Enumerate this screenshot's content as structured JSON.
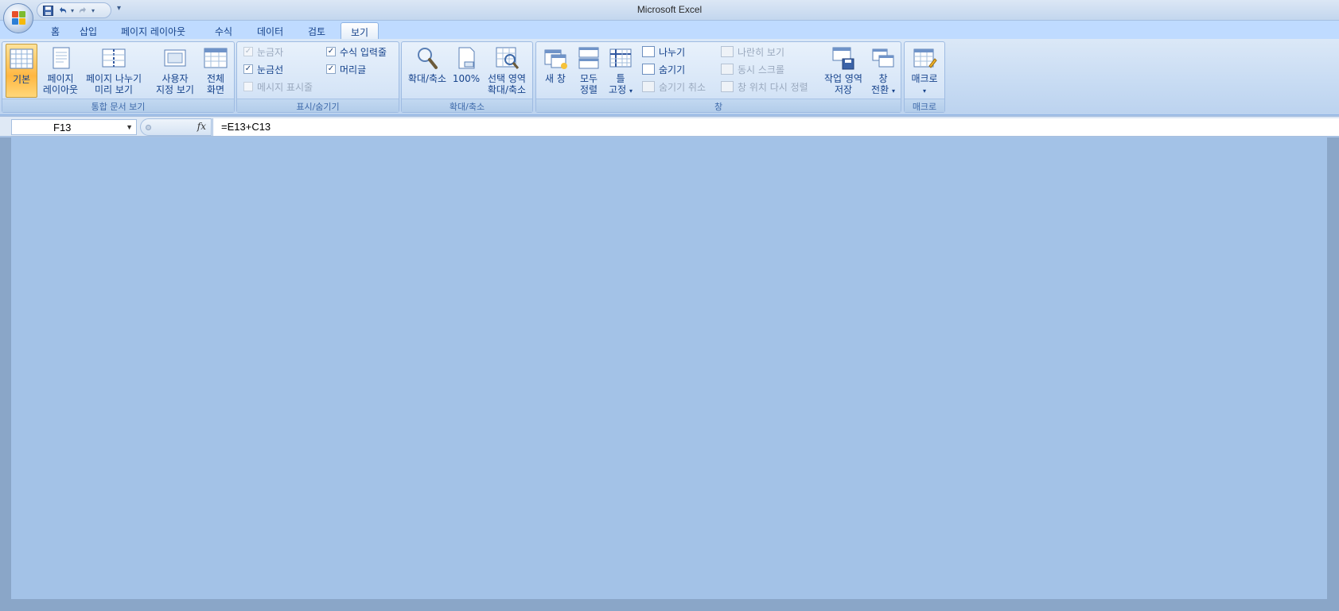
{
  "window": {
    "title": "Microsoft Excel"
  },
  "qat": {
    "save": "save-icon",
    "undo": "undo-icon",
    "redo": "redo-icon",
    "customize": "▾"
  },
  "tabs": [
    {
      "label": "홈"
    },
    {
      "label": "삽입"
    },
    {
      "label": "페이지 레이아웃"
    },
    {
      "label": "수식"
    },
    {
      "label": "데이터"
    },
    {
      "label": "검토"
    },
    {
      "label": "보기"
    }
  ],
  "active_tab": "보기",
  "ribbon": {
    "workbook_views": {
      "label": "통합 문서 보기",
      "normal": {
        "line1": "기본",
        "line2": ""
      },
      "page_layout": {
        "line1": "페이지",
        "line2": "레이아웃"
      },
      "page_break": {
        "line1": "페이지 나누기",
        "line2": "미리 보기"
      },
      "custom_views": {
        "line1": "사용자",
        "line2": "지정 보기"
      },
      "full_screen": {
        "line1": "전체",
        "line2": "화면"
      }
    },
    "show_hide": {
      "label": "표시/숨기기",
      "ruler": "눈금자",
      "gridlines": "눈금선",
      "message_bar": "메시지 표시줄",
      "formula_bar": "수식 입력줄",
      "headings": "머리글",
      "ruler_checked": true,
      "gridlines_checked": true,
      "message_bar_checked": false,
      "formula_bar_checked": true,
      "headings_checked": true
    },
    "zoom": {
      "label": "확대/축소",
      "zoom_btn": "확대/축소",
      "hundred": "100%",
      "zoom_selection": {
        "line1": "선택 영역",
        "line2": "확대/축소"
      }
    },
    "window": {
      "label": "창",
      "new_window": "새 창",
      "arrange_all": {
        "line1": "모두",
        "line2": "정렬"
      },
      "freeze_panes": {
        "line1": "틀",
        "line2": "고정"
      },
      "split": "나누기",
      "hide": "숨기기",
      "unhide": "숨기기 취소",
      "side_by_side": "나란히 보기",
      "sync_scroll": "동시 스크롤",
      "reset_position": "창 위치 다시 정렬",
      "save_workspace": {
        "line1": "작업 영역",
        "line2": "저장"
      },
      "switch_windows": {
        "line1": "창",
        "line2": "전환"
      }
    },
    "macros": {
      "label": "매크로",
      "macros_btn": "매크로"
    }
  },
  "formula_bar": {
    "name_box": "F13",
    "fx": "fx",
    "formula": "=E13+C13"
  }
}
